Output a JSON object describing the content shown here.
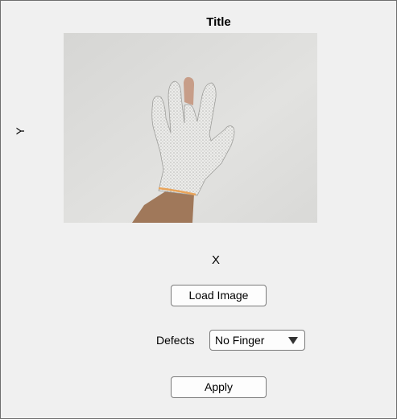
{
  "axes": {
    "title": "Title",
    "xlabel": "X",
    "ylabel": "Y",
    "image": "white knit glove with a finger missing"
  },
  "controls": {
    "load_button_label": "Load Image",
    "defects_label": "Defects",
    "defects_selected": "No Finger",
    "apply_button_label": "Apply"
  }
}
